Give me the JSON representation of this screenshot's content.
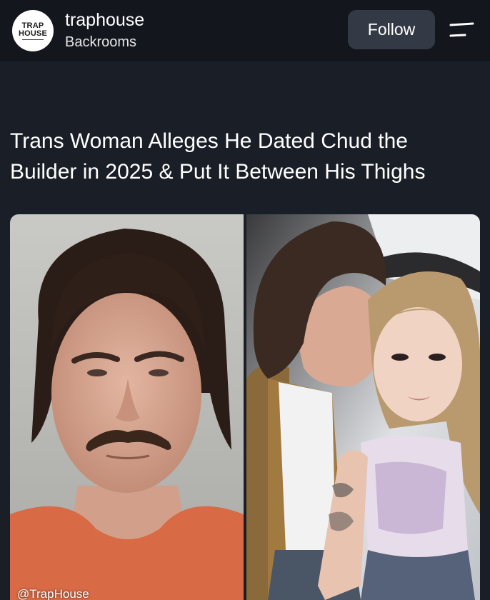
{
  "account": {
    "avatar_text_line1": "TRAP",
    "avatar_text_line2": "HOUSE",
    "name": "traphouse",
    "subtitle": "Backrooms"
  },
  "actions": {
    "follow_label": "Follow",
    "menu_icon": "menu-icon"
  },
  "post": {
    "headline": "Trans Woman Alleges He Dated Chud the Builder in 2025 & Put It Between His Thighs",
    "watermark": "@TrapHouse"
  },
  "colors": {
    "background": "#1a1e27",
    "header_bg": "#13161d",
    "button_bg": "#343a45",
    "text": "#ffffff"
  }
}
